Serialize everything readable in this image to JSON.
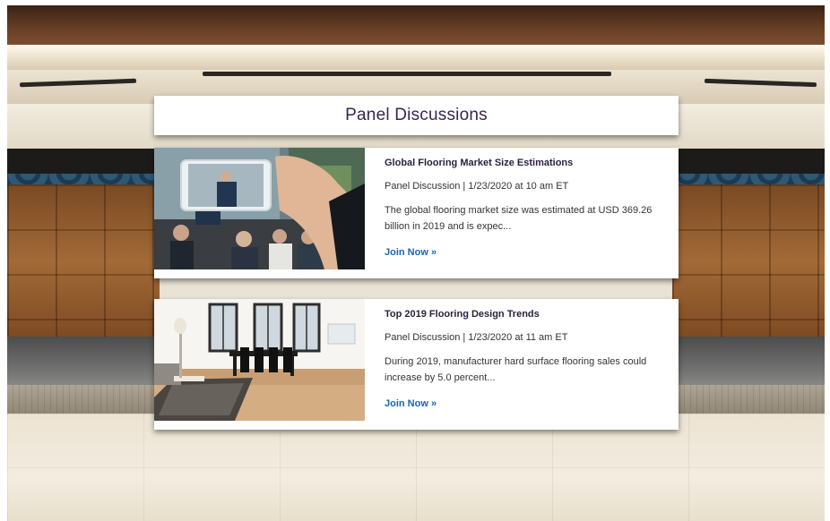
{
  "page": {
    "title": "Panel Discussions"
  },
  "sessions": [
    {
      "title": "Global Flooring Market Size Estimations",
      "meta": "Panel Discussion | 1/23/2020 at 10 am ET",
      "description": "The global flooring market size was estimated at USD 369.26 billion in 2019 and is expec...",
      "cta": "Join Now »",
      "image": "business-presentation-photo-through-phone"
    },
    {
      "title": "Top 2019 Flooring Design Trends",
      "meta": "Panel Discussion | 1/23/2020 at 11 am ET",
      "description": "During 2019, manufacturer hard surface flooring sales could increase by 5.0 percent...",
      "cta": "Join Now »",
      "image": "modern-living-room-hardwood-floor-photo"
    }
  ],
  "colors": {
    "title_text": "#3b2450",
    "link": "#1a63b8"
  }
}
